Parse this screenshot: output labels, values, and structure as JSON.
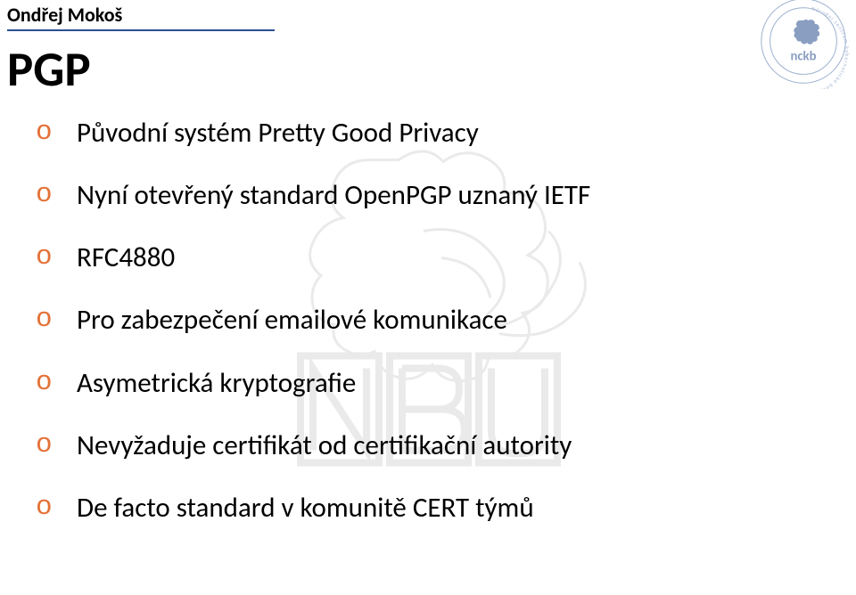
{
  "author": "Ondřej Mokoš",
  "title": "PGP",
  "bullets": [
    "Původní systém Pretty Good Privacy",
    "Nyní otevřený standard OpenPGP uznaný IETF",
    "RFC4880",
    "Pro zabezpečení emailové komunikace",
    "Asymetrická kryptografie",
    "Nevyžaduje certifikát od certifikační autority",
    "De facto standard v komunitě CERT týmů"
  ],
  "bullet_marker": "o",
  "badge": {
    "acronym": "nckb",
    "ring_text": "Národní centrum kybernetické bezpečnosti"
  }
}
